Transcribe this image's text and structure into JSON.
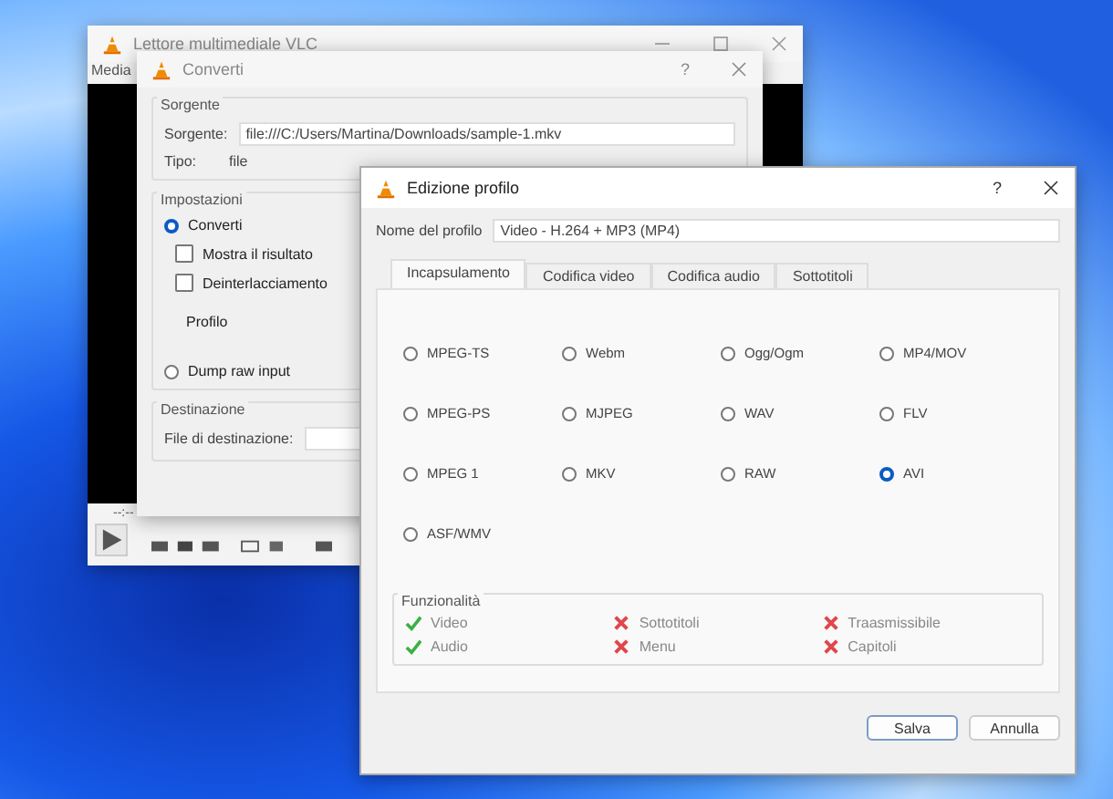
{
  "vlc_window": {
    "title": "Lettore multimediale VLC",
    "menu": [
      "Media"
    ],
    "time": "--:--"
  },
  "convert_dialog": {
    "title": "Converti",
    "help": "?",
    "source": {
      "legend": "Sorgente",
      "source_label": "Sorgente:",
      "source_value": "file:///C:/Users/Martina/Downloads/sample-1.mkv",
      "type_label": "Tipo:",
      "type_value": "file"
    },
    "settings": {
      "legend": "Impostazioni",
      "convert": {
        "label": "Converti",
        "selected": true
      },
      "checkboxes": [
        {
          "label": "Mostra il risultato",
          "checked": false
        },
        {
          "label": "Deinterlacciamento",
          "checked": false
        }
      ],
      "profile_label": "Profilo",
      "dump": {
        "label": "Dump raw input",
        "selected": false
      }
    },
    "destination": {
      "legend": "Destinazione",
      "file_label": "File di destinazione:"
    }
  },
  "profile_dialog": {
    "title": "Edizione profilo",
    "help": "?",
    "name_label": "Nome del profilo",
    "name_value": "Video - H.264 + MP3 (MP4)",
    "tabs": [
      {
        "label": "Incapsulamento",
        "selected": true
      },
      {
        "label": "Codifica video",
        "selected": false
      },
      {
        "label": "Codifica audio",
        "selected": false
      },
      {
        "label": "Sottotitoli",
        "selected": false
      }
    ],
    "encapsulations": [
      {
        "label": "MPEG-TS",
        "selected": false
      },
      {
        "label": "Webm",
        "selected": false
      },
      {
        "label": "Ogg/Ogm",
        "selected": false
      },
      {
        "label": "MP4/MOV",
        "selected": false
      },
      {
        "label": "MPEG-PS",
        "selected": false
      },
      {
        "label": "MJPEG",
        "selected": false
      },
      {
        "label": "WAV",
        "selected": false
      },
      {
        "label": "FLV",
        "selected": false
      },
      {
        "label": "MPEG 1",
        "selected": false
      },
      {
        "label": "MKV",
        "selected": false
      },
      {
        "label": "RAW",
        "selected": false
      },
      {
        "label": "AVI",
        "selected": true
      },
      {
        "label": "ASF/WMV",
        "selected": false
      }
    ],
    "features": {
      "legend": "Funzionalità",
      "items": [
        {
          "label": "Video",
          "supported": true
        },
        {
          "label": "Audio",
          "supported": true
        },
        {
          "label": "Sottotitoli",
          "supported": false
        },
        {
          "label": "Menu",
          "supported": false
        },
        {
          "label": "Traasmissibile",
          "supported": false
        },
        {
          "label": "Capitoli",
          "supported": false
        }
      ]
    },
    "buttons": [
      {
        "label": "Salva",
        "default": true
      },
      {
        "label": "Annulla",
        "default": false
      }
    ]
  }
}
